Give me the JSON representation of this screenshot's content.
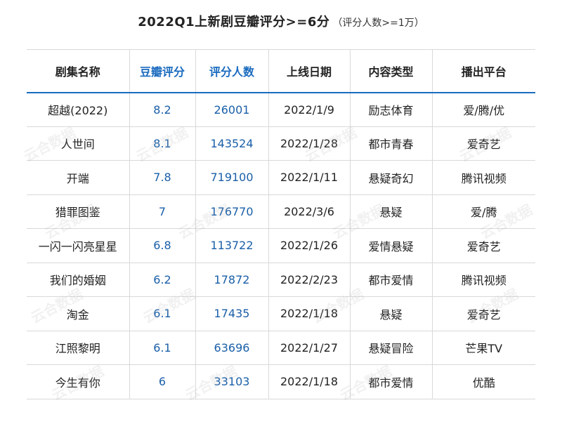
{
  "title": {
    "main": "2022Q1上新剧豆瓣评分>=6分",
    "sub": "（评分人数>=1万）"
  },
  "chart_data": {
    "type": "table",
    "columns": [
      "剧集名称",
      "豆瓣评分",
      "评分人数",
      "上线日期",
      "内容类型",
      "播出平台"
    ],
    "rows": [
      [
        "超越(2022)",
        "8.2",
        "26001",
        "2022/1/9",
        "励志体育",
        "爱/腾/优"
      ],
      [
        "人世间",
        "8.1",
        "143524",
        "2022/1/28",
        "都市青春",
        "爱奇艺"
      ],
      [
        "开端",
        "7.8",
        "719100",
        "2022/1/11",
        "悬疑奇幻",
        "腾讯视频"
      ],
      [
        "猎罪图鉴",
        "7",
        "176770",
        "2022/3/6",
        "悬疑",
        "爱/腾"
      ],
      [
        "一闪一闪亮星星",
        "6.8",
        "113722",
        "2022/1/26",
        "爱情悬疑",
        "爱奇艺"
      ],
      [
        "我们的婚姻",
        "6.2",
        "17872",
        "2022/2/23",
        "都市爱情",
        "腾讯视频"
      ],
      [
        "淘金",
        "6.1",
        "17435",
        "2022/1/18",
        "悬疑",
        "爱奇艺"
      ],
      [
        "江照黎明",
        "6.1",
        "63696",
        "2022/1/27",
        "悬疑冒险",
        "芒果TV"
      ],
      [
        "今生有你",
        "6",
        "33103",
        "2022/1/18",
        "都市爱情",
        "优酷"
      ]
    ]
  },
  "colors": {
    "accent": "#1a6bbf",
    "grid": "#d9d9d9"
  },
  "watermark": "云合数据"
}
